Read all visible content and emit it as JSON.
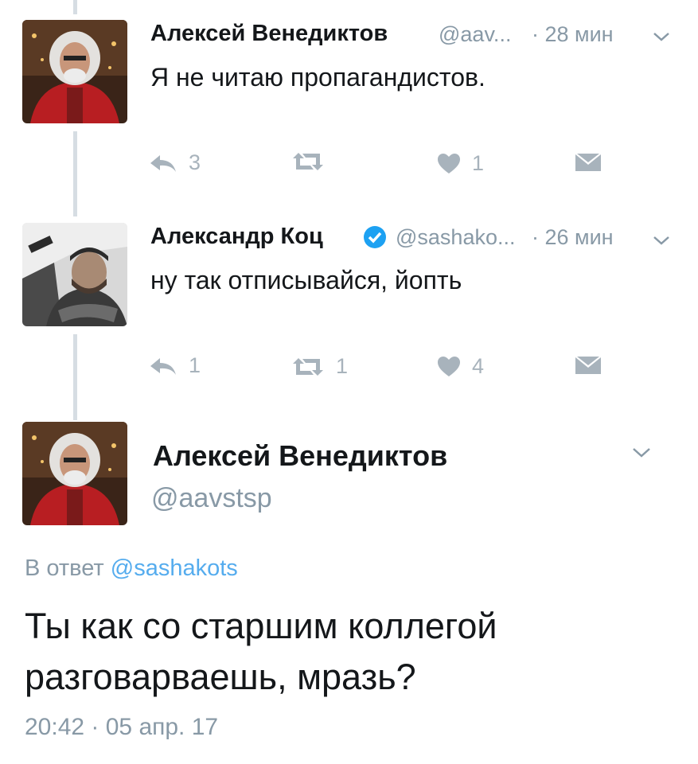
{
  "tweets": [
    {
      "name": "Алексей Венедиктов",
      "handle": "@aav...",
      "time": "· 28 мин",
      "text": "Я не читаю пропагандистов.",
      "reply_count": "3",
      "retweet_count": "",
      "like_count": "1"
    },
    {
      "name": "Александр Коц",
      "handle": "@sashako...",
      "time": "· 26 мин",
      "text": "ну так отписывайся, йопть",
      "reply_count": "1",
      "retweet_count": "1",
      "like_count": "4",
      "verified": true
    }
  ],
  "main": {
    "name": "Алексей Венедиктов",
    "handle": "@aavstsp",
    "reply_prefix": "В ответ",
    "reply_to": "@sashakots",
    "text_line1": "Ты как со старшим коллегой",
    "text_line2": "разговарваешь, мразь?",
    "timestamp": "20:42 · 05 апр. 17"
  },
  "colors": {
    "link": "#55acee",
    "muted": "#8899a6",
    "icon": "#a8b3bc",
    "verified": "#1da1f2",
    "thread_line": "#d6dde3"
  }
}
